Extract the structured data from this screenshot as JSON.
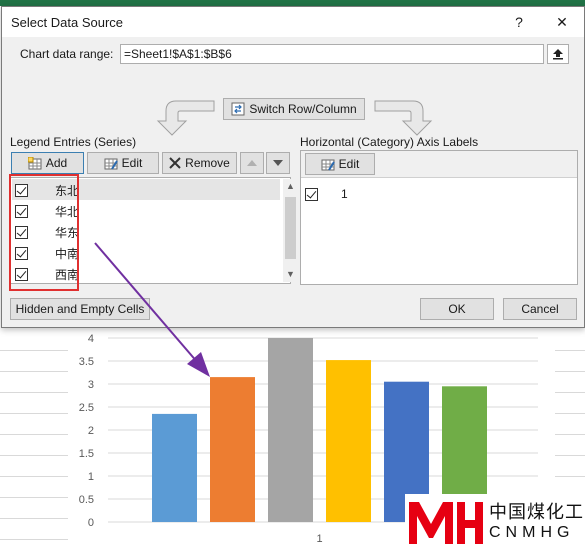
{
  "dialog": {
    "title": "Select Data Source",
    "help_label": "?",
    "close_label": "✕",
    "chart_range_label": "Chart data range:",
    "chart_range_value": "=Sheet1!$A$1:$B$6",
    "switch_label": "Switch Row/Column",
    "legend_label": "Legend Entries (Series)",
    "axis_label": "Horizontal (Category) Axis Labels",
    "add_label": "Add",
    "edit_label": "Edit",
    "remove_label": "Remove",
    "axis_edit_label": "Edit",
    "series": [
      {
        "name": "东北",
        "checked": true
      },
      {
        "name": "华北",
        "checked": true
      },
      {
        "name": "华东",
        "checked": true
      },
      {
        "name": "中南",
        "checked": true
      },
      {
        "name": "西南",
        "checked": true
      }
    ],
    "categories": [
      {
        "label": "1",
        "checked": true
      }
    ],
    "hidden_cells_label": "Hidden and Empty Cells",
    "ok_label": "OK",
    "cancel_label": "Cancel"
  },
  "chart_data": {
    "type": "bar",
    "categories": [
      "1"
    ],
    "series": [
      {
        "values": [
          2.35
        ],
        "color": "#5b9bd5"
      },
      {
        "values": [
          3.15
        ],
        "color": "#ed7d31"
      },
      {
        "values": [
          4.0
        ],
        "color": "#a5a5a5"
      },
      {
        "values": [
          3.52
        ],
        "color": "#ffc000"
      },
      {
        "values": [
          3.05
        ],
        "color": "#4472c4"
      },
      {
        "values": [
          2.95
        ],
        "color": "#70ad47"
      }
    ],
    "yticks": [
      "0",
      "0.5",
      "1",
      "1.5",
      "2",
      "2.5",
      "3",
      "3.5",
      "4"
    ],
    "ylim": [
      0,
      4
    ],
    "grid": true
  },
  "watermark": {
    "text_cn": "中国煤化工",
    "text_en": "CNMHG",
    "logo_color": "#e60012"
  }
}
